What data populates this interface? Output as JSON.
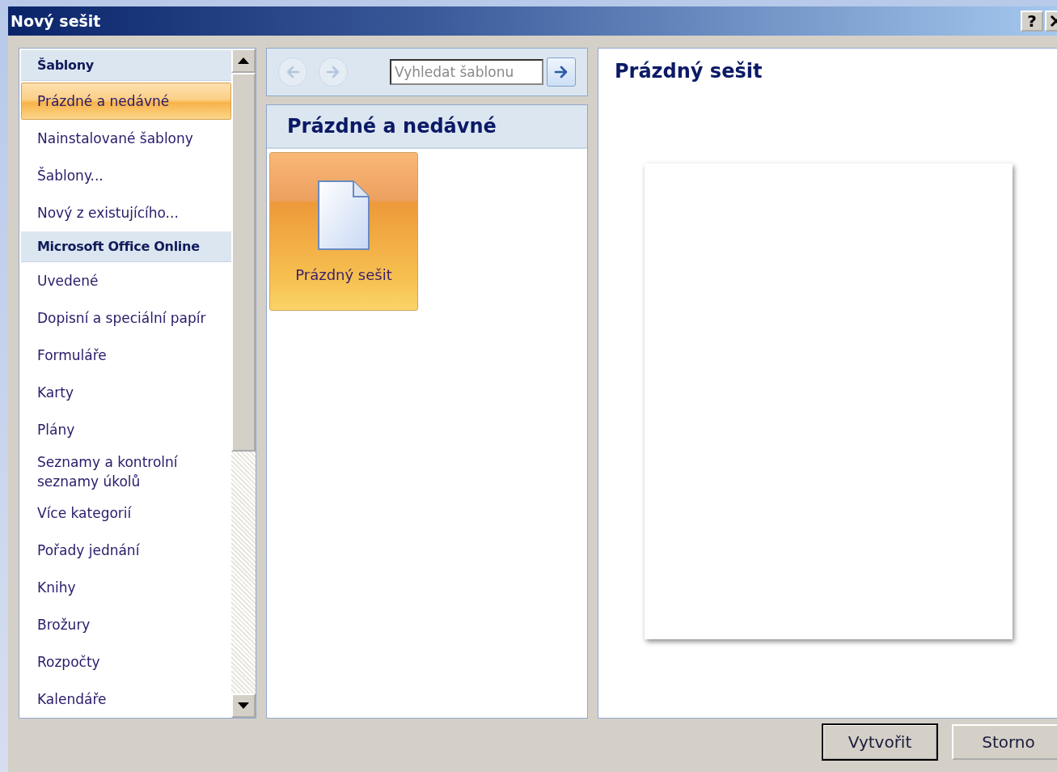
{
  "window": {
    "title": "Nový sešit",
    "help_button": "?"
  },
  "sidebar": {
    "items": [
      {
        "kind": "header",
        "label": "Šablony"
      },
      {
        "kind": "item",
        "label": "Prázdné a nedávné",
        "selected": true
      },
      {
        "kind": "item",
        "label": "Nainstalované šablony",
        "selected": false
      },
      {
        "kind": "item",
        "label": "Šablony...",
        "selected": false
      },
      {
        "kind": "item",
        "label": "Nový z existujícího...",
        "selected": false
      },
      {
        "kind": "header",
        "label": "Microsoft Office Online"
      },
      {
        "kind": "item",
        "label": "Uvedené",
        "selected": false
      },
      {
        "kind": "item",
        "label": "Dopisní a speciální papír",
        "selected": false
      },
      {
        "kind": "item",
        "label": "Formuláře",
        "selected": false
      },
      {
        "kind": "item",
        "label": "Karty",
        "selected": false
      },
      {
        "kind": "item",
        "label": "Plány",
        "selected": false
      },
      {
        "kind": "item",
        "label": "Seznamy a kontrolní seznamy úkolů",
        "selected": false
      },
      {
        "kind": "item",
        "label": "Více kategorií",
        "selected": false
      },
      {
        "kind": "item",
        "label": "Pořady jednání",
        "selected": false
      },
      {
        "kind": "item",
        "label": "Knihy",
        "selected": false
      },
      {
        "kind": "item",
        "label": "Brožury",
        "selected": false
      },
      {
        "kind": "item",
        "label": "Rozpočty",
        "selected": false
      },
      {
        "kind": "item",
        "label": "Kalendáře",
        "selected": false
      }
    ]
  },
  "navigation": {
    "back_disabled": true,
    "forward_disabled": true,
    "search": {
      "placeholder": "Vyhledat šablonu"
    }
  },
  "gallery": {
    "title": "Prázdné a nedávné",
    "templates": [
      {
        "label": "Prázdný sešit",
        "selected": true
      }
    ]
  },
  "preview": {
    "title": "Prázdný sešit"
  },
  "buttons": [
    {
      "label": "Vytvořit",
      "default": true
    },
    {
      "label": "Storno",
      "default": false
    }
  ]
}
